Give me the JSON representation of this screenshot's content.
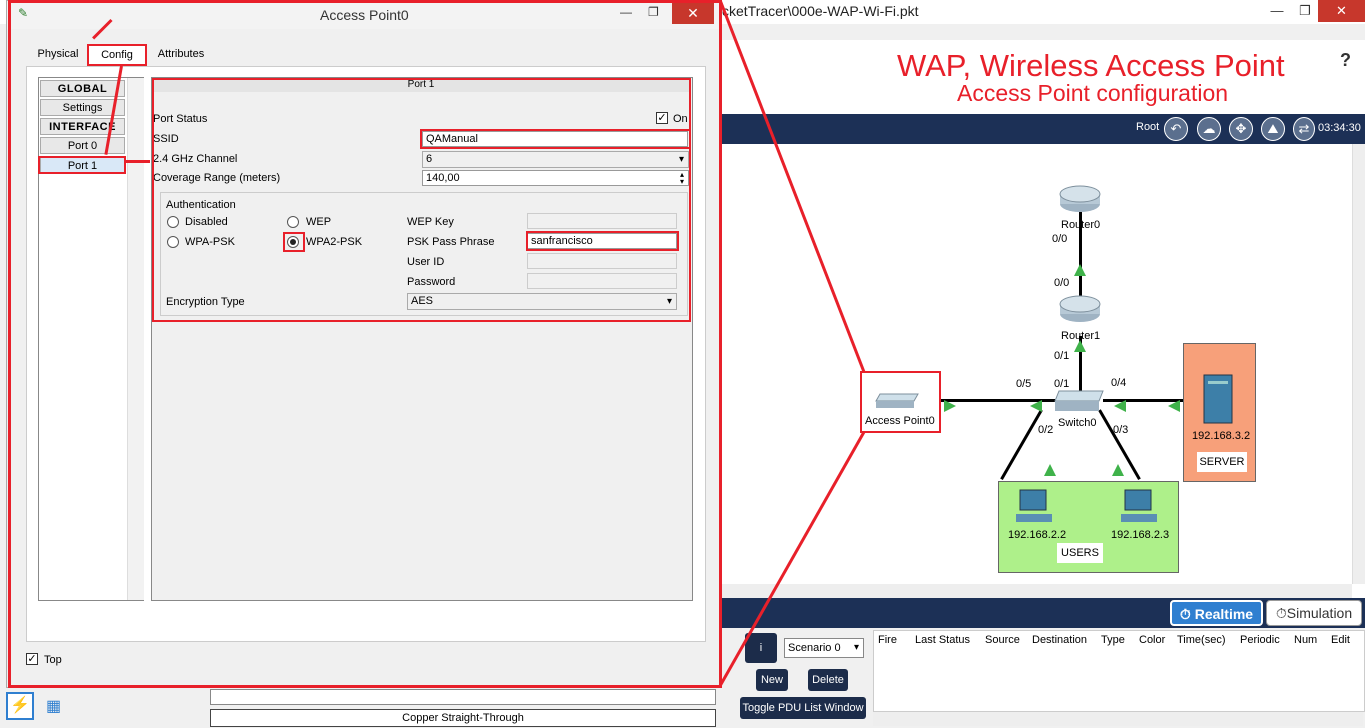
{
  "main_window": {
    "title": "cketTracer\\000e-WAP-Wi-Fi.pkt",
    "min": "—",
    "max": "❐",
    "close": "✕"
  },
  "annotation": {
    "title": "WAP, Wireless Access Point",
    "subtitle": "Access Point configuration"
  },
  "help": "?",
  "logical_bar": {
    "root": "Root",
    "clock": "03:34:30"
  },
  "topology": {
    "devices": {
      "router0": "Router0",
      "router1": "Router1",
      "switch0": "Switch0",
      "access_point": "Access Point0",
      "server_ip": "192.168.3.2",
      "server_label": "SERVER",
      "pc1_ip": "192.168.2.2",
      "pc2_ip": "192.168.2.3",
      "users_label": "USERS"
    },
    "ports": {
      "r0_down": "0/0",
      "r1_up": "0/0",
      "r1_down": "0/1",
      "sw_up": "0/1",
      "sw_ap": "0/5",
      "sw_server": "0/4",
      "sw_pc1": "0/2",
      "sw_pc2": "0/3"
    }
  },
  "mode": {
    "realtime": "Realtime",
    "simulation": "Simulation"
  },
  "scenario": {
    "info": "i",
    "select": "Scenario 0",
    "new": "New",
    "delete": "Delete",
    "toggle": "Toggle PDU List Window"
  },
  "pdu_columns": [
    "Fire",
    "Last Status",
    "Source",
    "Destination",
    "Type",
    "Color",
    "Time(sec)",
    "Periodic",
    "Num",
    "Edit"
  ],
  "device_panel": {
    "cable": "Copper Straight-Through"
  },
  "ap_window": {
    "title": "Access Point0",
    "tabs": {
      "physical": "Physical",
      "config": "Config",
      "attributes": "Attributes"
    },
    "nav": {
      "global": "GLOBAL",
      "settings": "Settings",
      "interface": "INTERFACE",
      "port0": "Port 0",
      "port1": "Port 1"
    },
    "port": {
      "header": "Port 1",
      "status_label": "Port Status",
      "status_on": "On",
      "ssid_label": "SSID",
      "ssid_value": "QAManual",
      "channel_label": "2.4 GHz Channel",
      "channel_value": "6",
      "coverage_label": "Coverage Range (meters)",
      "coverage_value": "140,00",
      "auth_label": "Authentication",
      "disabled": "Disabled",
      "wep": "WEP",
      "wpa_psk": "WPA-PSK",
      "wpa2_psk": "WPA2-PSK",
      "wep_key": "WEP Key",
      "psk_pass": "PSK Pass Phrase",
      "psk_value": "sanfrancisco",
      "user_id": "User ID",
      "password": "Password",
      "enc_label": "Encryption Type",
      "enc_value": "AES"
    },
    "top_checkbox": "Top"
  }
}
